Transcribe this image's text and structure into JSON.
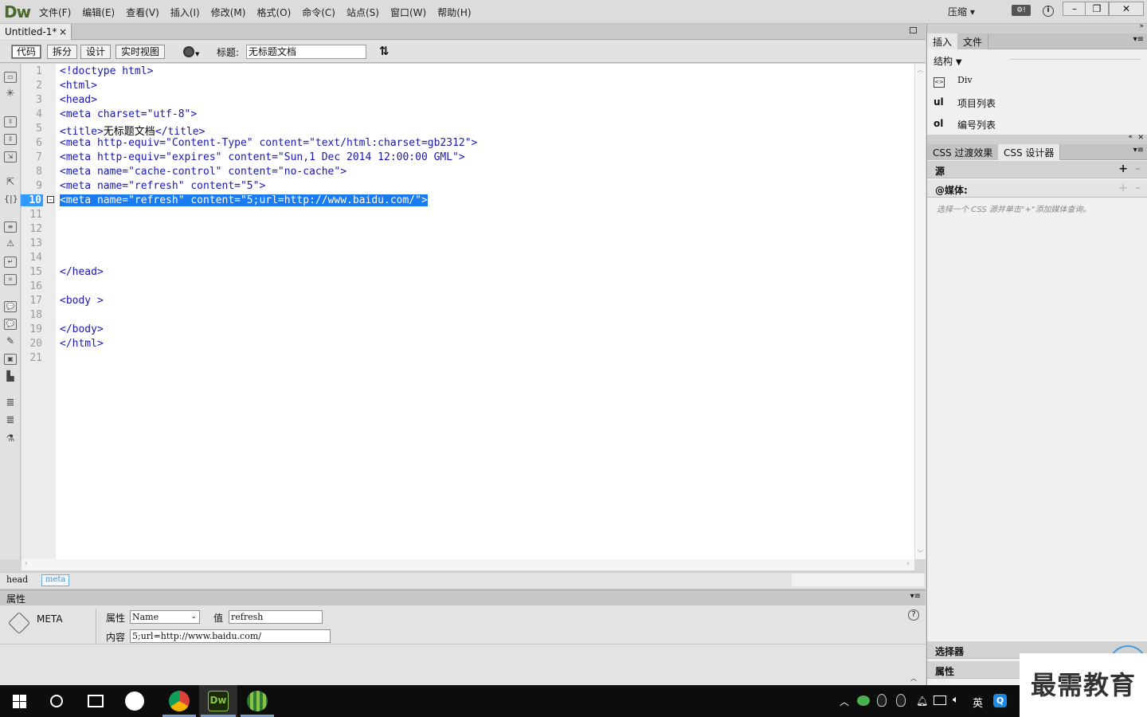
{
  "app": {
    "logo": "Dw",
    "compress": "压缩"
  },
  "menu": [
    "文件(F)",
    "编辑(E)",
    "查看(V)",
    "插入(I)",
    "修改(M)",
    "格式(O)",
    "命令(C)",
    "站点(S)",
    "窗口(W)",
    "帮助(H)"
  ],
  "doc_tab": {
    "name": "Untitled-1*",
    "close": "×"
  },
  "view_buttons": [
    "代码",
    "拆分",
    "设计",
    "实时视图"
  ],
  "title_label": "标题:",
  "title_value": "无标题文档",
  "code_lines": [
    {
      "n": "1",
      "text": "<!doctype html>"
    },
    {
      "n": "2",
      "text": "<html>"
    },
    {
      "n": "3",
      "text": "<head>"
    },
    {
      "n": "4",
      "text": "<meta charset=\"utf-8\">"
    },
    {
      "n": "5",
      "pre": "<title>",
      "mid": "无标题文档",
      "post": "</title>"
    },
    {
      "n": "6",
      "text": "<meta http-equiv=\"Content-Type\" content=\"text/html:charset=gb2312\">"
    },
    {
      "n": "7",
      "text": "<meta http-equiv=\"expires\" content=\"Sun,1 Dec 2014 12:00:00 GML\">"
    },
    {
      "n": "8",
      "text": "<meta name=\"cache-control\" content=\"no-cache\">"
    },
    {
      "n": "9",
      "text": "<meta name=\"refresh\" content=\"5\">"
    },
    {
      "n": "10",
      "text": "<meta name=\"refresh\" content=\"5;url=http://www.baidu.com/\">"
    },
    {
      "n": "11",
      "text": ""
    },
    {
      "n": "12",
      "text": ""
    },
    {
      "n": "13",
      "text": ""
    },
    {
      "n": "14",
      "text": ""
    },
    {
      "n": "15",
      "text": "</head>"
    },
    {
      "n": "16",
      "text": ""
    },
    {
      "n": "17",
      "text": "<body >"
    },
    {
      "n": "18",
      "text": ""
    },
    {
      "n": "19",
      "text": "</body>"
    },
    {
      "n": "20",
      "text": "</html>"
    },
    {
      "n": "21",
      "text": ""
    }
  ],
  "current_line": "10",
  "tag_selector": {
    "head": "head",
    "meta": "meta"
  },
  "properties": {
    "header": "属性",
    "tag": "META",
    "attr_label": "属性",
    "attr_value": "Name",
    "val_label": "值",
    "val_value": "refresh",
    "content_label": "内容",
    "content_value": "5;url=http://www.baidu.com/"
  },
  "insert_panel": {
    "tabs": [
      "插入",
      "文件"
    ],
    "category": "结构",
    "items": [
      {
        "icon": "<>",
        "label": "Div"
      },
      {
        "icon": "ul",
        "label": "项目列表"
      },
      {
        "icon": "ol",
        "label": "编号列表"
      }
    ]
  },
  "css_panel": {
    "tabs": [
      "CSS 过渡效果",
      "CSS 设计器"
    ],
    "source": "源",
    "media": "@媒体:",
    "hint": "选择一个 CSS 源并单击\"+\"添加媒体查询。",
    "selectors": "选择器",
    "props": "属性"
  },
  "taskbar": {
    "ime": "英"
  },
  "watermark": "最需教育"
}
